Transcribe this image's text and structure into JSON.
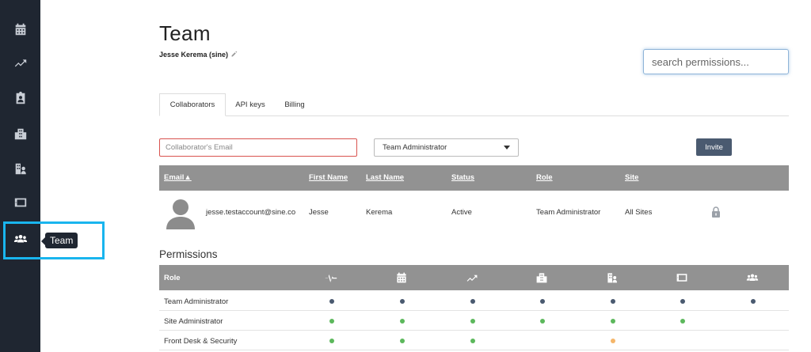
{
  "sidebar": {
    "items": [
      {
        "name": "calendar-icon"
      },
      {
        "name": "trending-icon"
      },
      {
        "name": "clipboard-user-icon"
      },
      {
        "name": "building-icon"
      },
      {
        "name": "building-user-icon"
      },
      {
        "name": "tablet-icon"
      },
      {
        "name": "team-icon",
        "active": true
      }
    ],
    "tooltip": "Team"
  },
  "header": {
    "title": "Team",
    "subtitle": "Jesse Kerema (sine)"
  },
  "search": {
    "placeholder": "search permissions..."
  },
  "tabs": [
    "Collaborators",
    "API keys",
    "Billing"
  ],
  "invite": {
    "email_placeholder": "Collaborator's Email",
    "role_selected": "Team Administrator",
    "button_label": "Invite"
  },
  "collaborators": {
    "columns": [
      "Email▲",
      "First Name",
      "Last Name",
      "Status",
      "Role",
      "Site"
    ],
    "rows": [
      {
        "email": "jesse.testaccount@sine.co",
        "first_name": "Jesse",
        "last_name": "Kerema",
        "status": "Active",
        "role": "Team Administrator",
        "site": "All Sites"
      }
    ]
  },
  "permissions": {
    "title": "Permissions",
    "role_header": "Role",
    "columns": [
      "activity-icon",
      "calendar-icon",
      "trending-icon",
      "building-icon",
      "building-user-icon",
      "tablet-icon",
      "team-icon"
    ],
    "rows": [
      {
        "role": "Team Administrator",
        "dots": [
          "navy",
          "navy",
          "navy",
          "navy",
          "navy",
          "navy",
          "navy"
        ]
      },
      {
        "role": "Site Administrator",
        "dots": [
          "green",
          "green",
          "green",
          "green",
          "green",
          "green",
          ""
        ]
      },
      {
        "role": "Front Desk & Security",
        "dots": [
          "green",
          "green",
          "green",
          "",
          "orange",
          "",
          ""
        ]
      }
    ]
  },
  "colors": {
    "sidebar_bg": "#1f2631",
    "highlight": "#19b5ee",
    "navy": "#4a5a70",
    "green": "#5cb85c",
    "orange": "#f5b66a"
  }
}
